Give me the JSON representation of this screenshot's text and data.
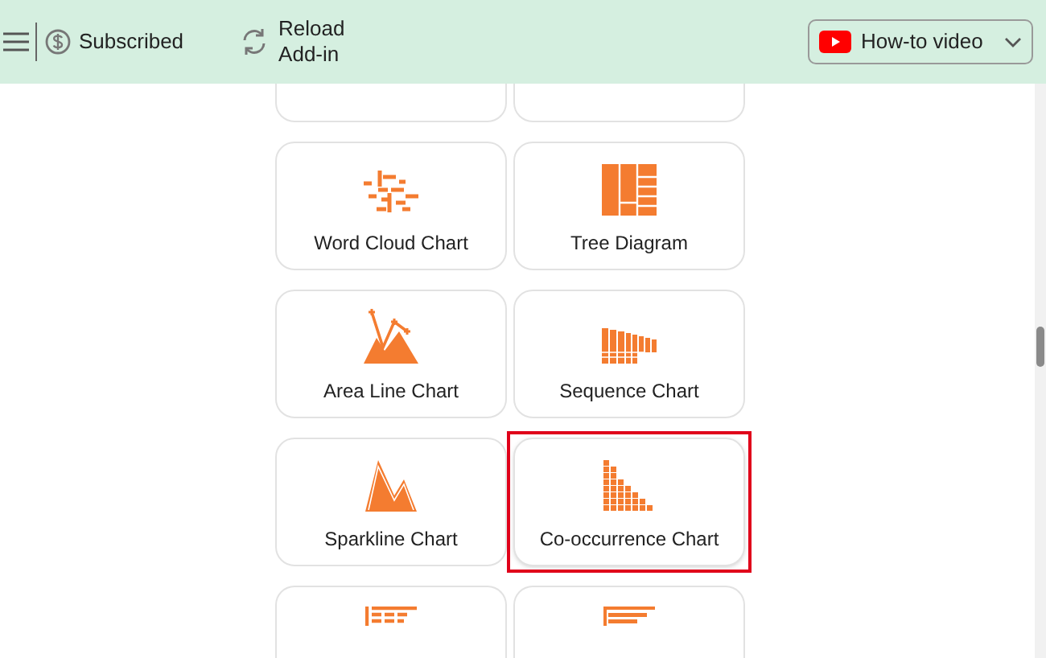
{
  "toolbar": {
    "status": "Subscribed",
    "reload": "Reload\nAdd-in",
    "video_button": "How-to video"
  },
  "cards": [
    {
      "kind": "partial",
      "selected": false
    },
    {
      "kind": "partial",
      "selected": false
    },
    {
      "kind": "full",
      "label": "Word Cloud Chart",
      "selected": false
    },
    {
      "kind": "full",
      "label": "Tree Diagram",
      "selected": false
    },
    {
      "kind": "full",
      "label": "Area Line Chart",
      "selected": false
    },
    {
      "kind": "full",
      "label": "Sequence Chart",
      "selected": false
    },
    {
      "kind": "full",
      "label": "Sparkline Chart",
      "selected": false
    },
    {
      "kind": "full",
      "label": "Co-occurrence Chart",
      "selected": true
    },
    {
      "kind": "cut",
      "selected": false
    },
    {
      "kind": "cut",
      "selected": false
    }
  ]
}
